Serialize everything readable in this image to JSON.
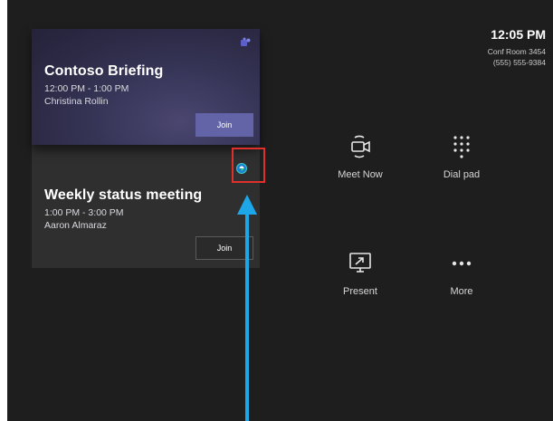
{
  "status": {
    "time": "12:05 PM",
    "room": "Conf Room 3454",
    "phone": "(555) 555-9384"
  },
  "meetings": [
    {
      "title": "Contoso Briefing",
      "time": "12:00 PM - 1:00 PM",
      "organizer": "Christina Rollin",
      "join_label": "Join",
      "icon": "teams-icon"
    },
    {
      "title": "Weekly status meeting",
      "time": "1:00 PM - 3:00 PM",
      "organizer": "Aaron Almaraz",
      "join_label": "Join",
      "icon": "third-party-provider-icon"
    }
  ],
  "actions": {
    "meet_now": "Meet Now",
    "dial_pad": "Dial pad",
    "present": "Present",
    "more": "More"
  },
  "colors": {
    "accent": "#6264a7",
    "highlight": "#e0302b",
    "arrow": "#1ea7e8"
  }
}
